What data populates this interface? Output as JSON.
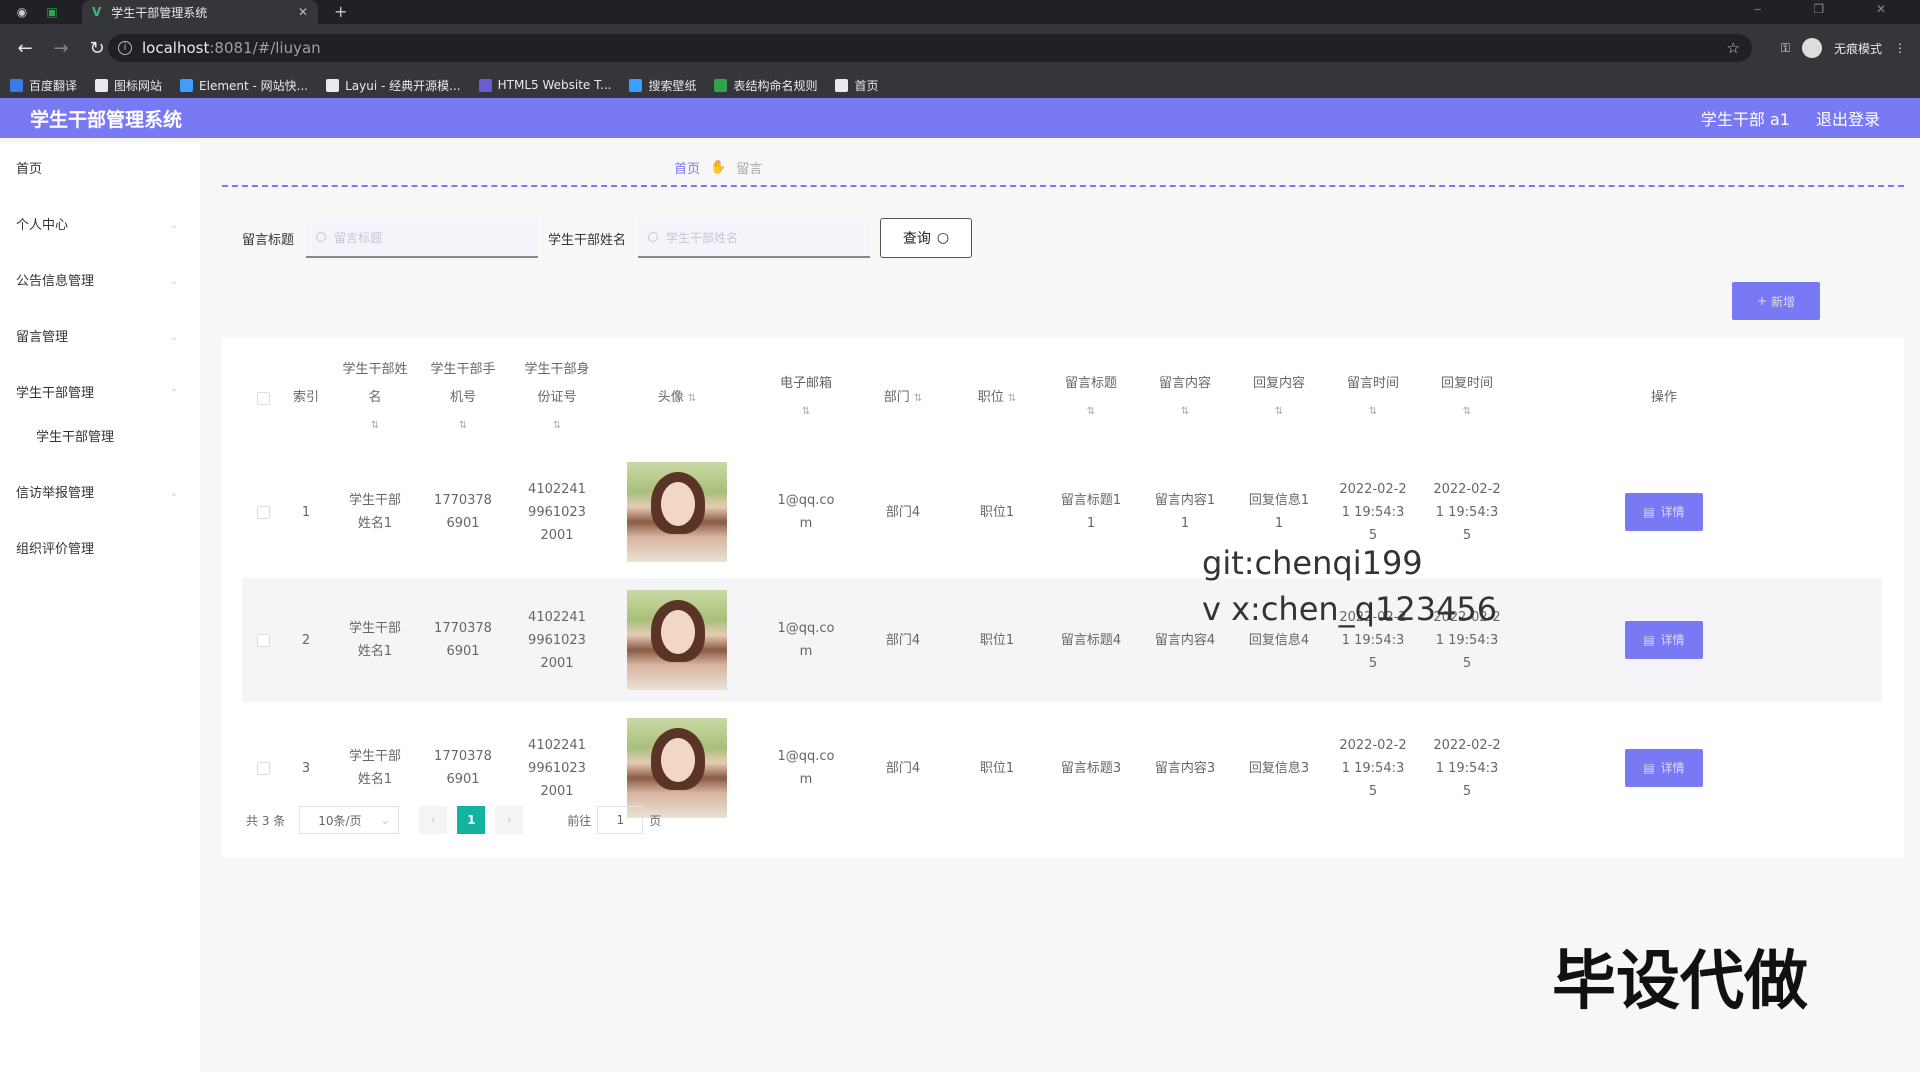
{
  "browser": {
    "tab_title": "学生干部管理系统",
    "url_host": "localhost",
    "url_path": ":8081/#/liuyan",
    "incognito_label": "无痕模式"
  },
  "bookmarks": [
    {
      "label": "百度翻译",
      "color": "#3a7bea"
    },
    {
      "label": "图标网站",
      "color": "#e8eaed"
    },
    {
      "label": "Element - 网站快...",
      "color": "#409eff"
    },
    {
      "label": "Layui - 经典开源模...",
      "color": "#e8eaed"
    },
    {
      "label": "HTML5 Website T...",
      "color": "#6b5cd6"
    },
    {
      "label": "搜索壁纸",
      "color": "#3aa0ff"
    },
    {
      "label": "表结构命名规则",
      "color": "#2ea44f"
    },
    {
      "label": "首页",
      "color": "#e8eaed"
    }
  ],
  "header": {
    "title": "学生干部管理系统",
    "user": "学生干部 a1",
    "logout": "退出登录"
  },
  "sidebar": {
    "items": [
      {
        "label": "首页"
      },
      {
        "label": "个人中心"
      },
      {
        "label": "公告信息管理"
      },
      {
        "label": "留言管理"
      },
      {
        "label": "学生干部管理"
      },
      {
        "label": "学生干部管理",
        "sub": true
      },
      {
        "label": "信访举报管理"
      },
      {
        "label": "组织评价管理"
      }
    ]
  },
  "breadcrumb": {
    "home": "首页",
    "current": "留言"
  },
  "search": {
    "label1": "留言标题",
    "placeholder1": "留言标题",
    "label2": "学生干部姓名",
    "placeholder2": "学生干部姓名",
    "query": "查询"
  },
  "add_button": "新增",
  "table": {
    "headers": {
      "index": "索引",
      "name": "学生干部姓名",
      "phone": "学生干部手机号",
      "id": "学生干部身份证号",
      "avatar": "头像",
      "email": "电子邮箱",
      "dept": "部门",
      "position": "职位",
      "title": "留言标题",
      "content": "留言内容",
      "reply": "回复内容",
      "time": "留言时间",
      "rtime": "回复时间",
      "op": "操作"
    },
    "rows": [
      {
        "index": "1",
        "name": "学生干部姓名1",
        "phone": "17703786901",
        "id": "410224199610232001",
        "email": "1@qq.com",
        "dept": "部门4",
        "position": "职位1",
        "title": "留言标题11",
        "content": "留言内容11",
        "reply": "回复信息11",
        "time": "2022-02-21 19:54:35",
        "rtime": "2022-02-21 19:54:35"
      },
      {
        "index": "2",
        "name": "学生干部姓名1",
        "phone": "17703786901",
        "id": "410224199610232001",
        "email": "1@qq.com",
        "dept": "部门4",
        "position": "职位1",
        "title": "留言标题4",
        "content": "留言内容4",
        "reply": "回复信息4",
        "time": "2022-02-21 19:54:35",
        "rtime": "2022-02-21 19:54:35"
      },
      {
        "index": "3",
        "name": "学生干部姓名1",
        "phone": "17703786901",
        "id": "410224199610232001",
        "email": "1@qq.com",
        "dept": "部门4",
        "position": "职位1",
        "title": "留言标题3",
        "content": "留言内容3",
        "reply": "回复信息3",
        "time": "2022-02-21 19:54:35",
        "rtime": "2022-02-21 19:54:35"
      }
    ],
    "detail_label": "详情"
  },
  "pagination": {
    "total": "共 3 条",
    "page_size": "10条/页",
    "current": "1",
    "goto_prefix": "前往",
    "goto_value": "1",
    "goto_suffix": "页"
  },
  "overlay": {
    "line1": "git:chenqi199",
    "line2": "v x:chen_q123456",
    "stamp": "毕设代做"
  }
}
